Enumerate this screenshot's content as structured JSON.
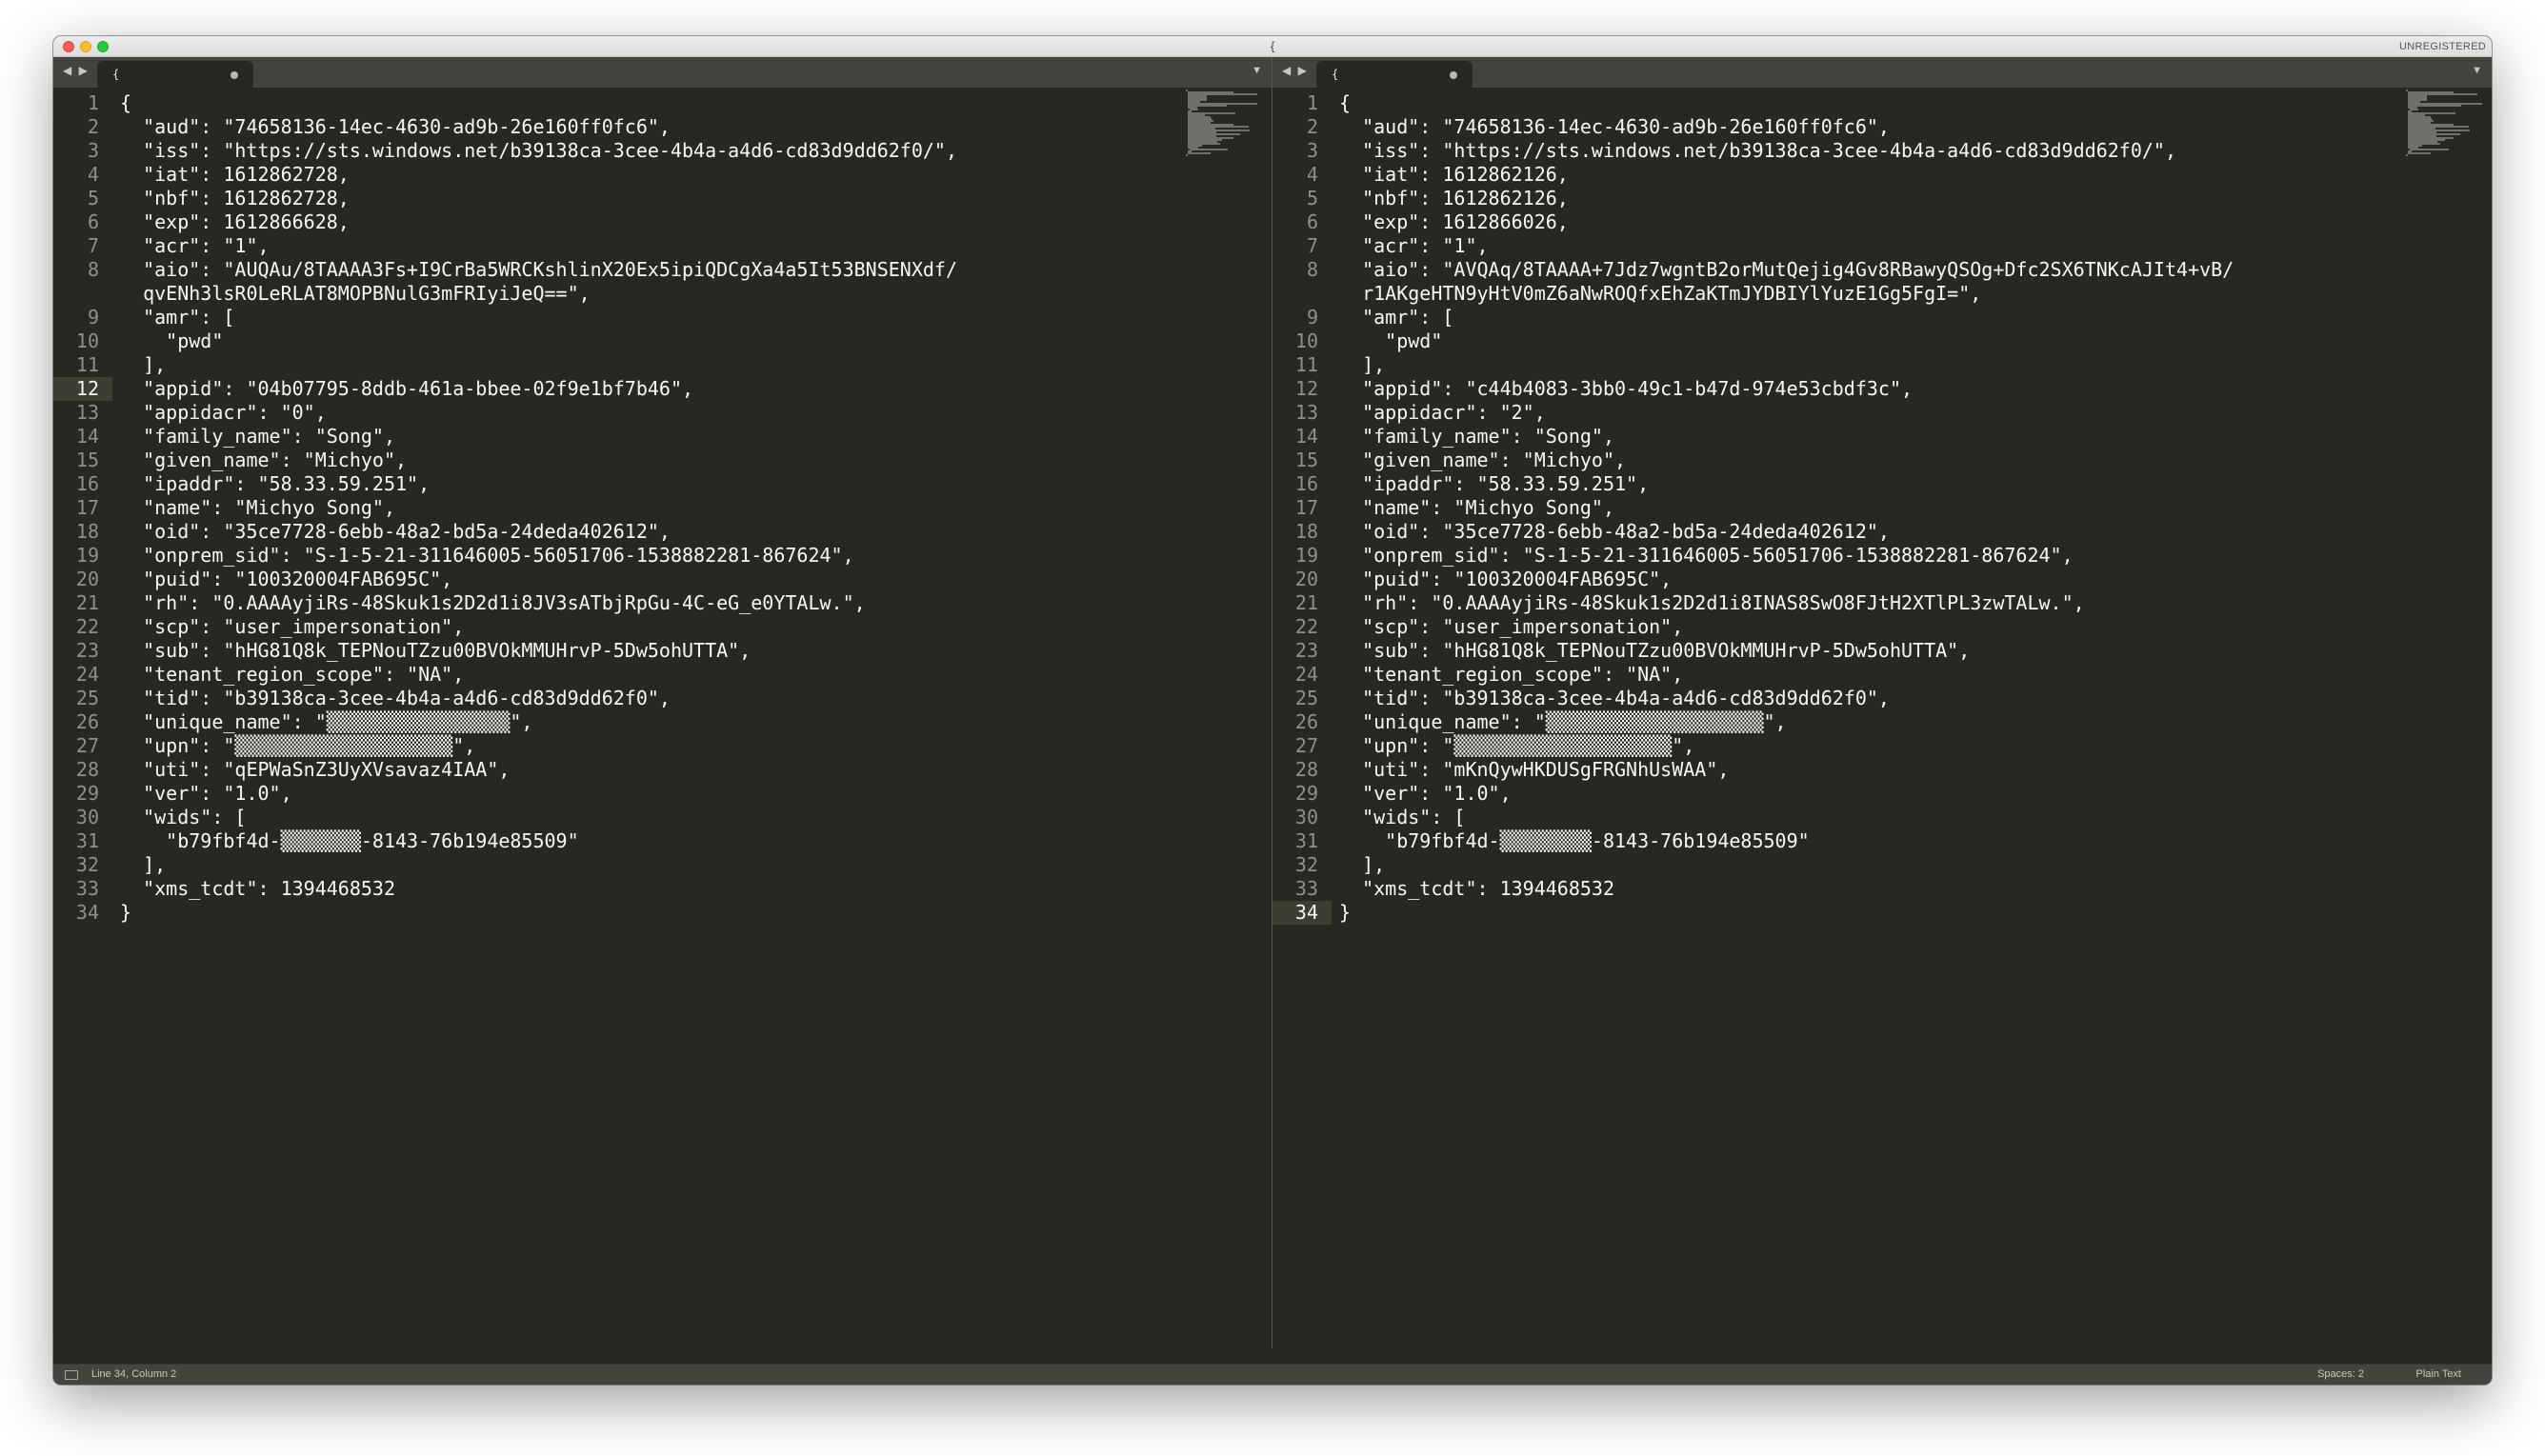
{
  "window": {
    "title": "{",
    "registration": "UNREGISTERED",
    "nav_arrows": "◀ ▶"
  },
  "status": {
    "position": "Line 34, Column 2",
    "spaces": "Spaces: 2",
    "syntax": "Plain Text"
  },
  "colors": {
    "editor_bg": "#272822",
    "text": "#f8f8f2",
    "line_numbers": "#8f908a",
    "chrome": "#43443d"
  },
  "panes": [
    {
      "tab_title": "{",
      "current_line": 12,
      "lines": [
        {
          "n": "1",
          "t": "{"
        },
        {
          "n": "2",
          "t": "  \"aud\": \"74658136-14ec-4630-ad9b-26e160ff0fc6\","
        },
        {
          "n": "3",
          "t": "  \"iss\": \"https://sts.windows.net/b39138ca-3cee-4b4a-a4d6-cd83d9dd62f0/\","
        },
        {
          "n": "4",
          "t": "  \"iat\": 1612862728,"
        },
        {
          "n": "5",
          "t": "  \"nbf\": 1612862728,"
        },
        {
          "n": "6",
          "t": "  \"exp\": 1612866628,"
        },
        {
          "n": "7",
          "t": "  \"acr\": \"1\","
        },
        {
          "n": "8",
          "t": "  \"aio\": \"AUQAu/8TAAAA3Fs+I9CrBa5WRCKshlinX20Ex5ipiQDCgXa4a5It53BNSENXdf/"
        },
        {
          "n": "",
          "t": "  qvENh3lsR0LeRLAT8MOPBNulG3mFRIyiJeQ==\","
        },
        {
          "n": "9",
          "t": "  \"amr\": ["
        },
        {
          "n": "10",
          "t": "    \"pwd\""
        },
        {
          "n": "11",
          "t": "  ],"
        },
        {
          "n": "12",
          "t": "  \"appid\": \"04b07795-8ddb-461a-bbee-02f9e1bf7b46\","
        },
        {
          "n": "13",
          "t": "  \"appidacr\": \"0\","
        },
        {
          "n": "14",
          "t": "  \"family_name\": \"Song\","
        },
        {
          "n": "15",
          "t": "  \"given_name\": \"Michyo\","
        },
        {
          "n": "16",
          "t": "  \"ipaddr\": \"58.33.59.251\","
        },
        {
          "n": "17",
          "t": "  \"name\": \"Michyo Song\","
        },
        {
          "n": "18",
          "t": "  \"oid\": \"35ce7728-6ebb-48a2-bd5a-24deda402612\","
        },
        {
          "n": "19",
          "t": "  \"onprem_sid\": \"S-1-5-21-311646005-56051706-1538882281-867624\","
        },
        {
          "n": "20",
          "t": "  \"puid\": \"100320004FAB695C\","
        },
        {
          "n": "21",
          "t": "  \"rh\": \"0.AAAAyjiRs-48Skuk1s2D2d1i8JV3sATbjRpGu-4C-eG_e0YTALw.\","
        },
        {
          "n": "22",
          "t": "  \"scp\": \"user_impersonation\","
        },
        {
          "n": "23",
          "t": "  \"sub\": \"hHG81Q8k_TEPNouTZzu00BVOkMMUHrvP-5Dw5ohUTTA\","
        },
        {
          "n": "24",
          "t": "  \"tenant_region_scope\": \"NA\","
        },
        {
          "n": "25",
          "t": "  \"tid\": \"b39138ca-3cee-4b4a-a4d6-cd83d9dd62f0\","
        },
        {
          "n": "26",
          "t": "  \"unique_name\": \"▒▒▒▒▒▒▒▒▒▒▒▒▒▒▒▒\","
        },
        {
          "n": "27",
          "t": "  \"upn\": \"▒▒▒▒▒▒▒▒▒▒▒▒▒▒▒▒▒▒▒\","
        },
        {
          "n": "28",
          "t": "  \"uti\": \"qEPWaSnZ3UyXVsavaz4IAA\","
        },
        {
          "n": "29",
          "t": "  \"ver\": \"1.0\","
        },
        {
          "n": "30",
          "t": "  \"wids\": ["
        },
        {
          "n": "31",
          "t": "    \"b79fbf4d-▒▒▒▒▒▒▒-8143-76b194e85509\""
        },
        {
          "n": "32",
          "t": "  ],"
        },
        {
          "n": "33",
          "t": "  \"xms_tcdt\": 1394468532"
        },
        {
          "n": "34",
          "t": "}"
        }
      ]
    },
    {
      "tab_title": "{",
      "current_line": 34,
      "lines": [
        {
          "n": "1",
          "t": "{"
        },
        {
          "n": "2",
          "t": "  \"aud\": \"74658136-14ec-4630-ad9b-26e160ff0fc6\","
        },
        {
          "n": "3",
          "t": "  \"iss\": \"https://sts.windows.net/b39138ca-3cee-4b4a-a4d6-cd83d9dd62f0/\","
        },
        {
          "n": "4",
          "t": "  \"iat\": 1612862126,"
        },
        {
          "n": "5",
          "t": "  \"nbf\": 1612862126,"
        },
        {
          "n": "6",
          "t": "  \"exp\": 1612866026,"
        },
        {
          "n": "7",
          "t": "  \"acr\": \"1\","
        },
        {
          "n": "8",
          "t": "  \"aio\": \"AVQAq/8TAAAA+7Jdz7wgntB2orMutQejig4Gv8RBawyQSOg+Dfc2SX6TNKcAJIt4+vB/"
        },
        {
          "n": "",
          "t": "  r1AKgeHTN9yHtV0mZ6aNwROQfxEhZaKTmJYDBIYlYuzE1Gg5FgI=\","
        },
        {
          "n": "9",
          "t": "  \"amr\": ["
        },
        {
          "n": "10",
          "t": "    \"pwd\""
        },
        {
          "n": "11",
          "t": "  ],"
        },
        {
          "n": "12",
          "t": "  \"appid\": \"c44b4083-3bb0-49c1-b47d-974e53cbdf3c\","
        },
        {
          "n": "13",
          "t": "  \"appidacr\": \"2\","
        },
        {
          "n": "14",
          "t": "  \"family_name\": \"Song\","
        },
        {
          "n": "15",
          "t": "  \"given_name\": \"Michyo\","
        },
        {
          "n": "16",
          "t": "  \"ipaddr\": \"58.33.59.251\","
        },
        {
          "n": "17",
          "t": "  \"name\": \"Michyo Song\","
        },
        {
          "n": "18",
          "t": "  \"oid\": \"35ce7728-6ebb-48a2-bd5a-24deda402612\","
        },
        {
          "n": "19",
          "t": "  \"onprem_sid\": \"S-1-5-21-311646005-56051706-1538882281-867624\","
        },
        {
          "n": "20",
          "t": "  \"puid\": \"100320004FAB695C\","
        },
        {
          "n": "21",
          "t": "  \"rh\": \"0.AAAAyjiRs-48Skuk1s2D2d1i8INAS8SwO8FJtH2XTlPL3zwTALw.\","
        },
        {
          "n": "22",
          "t": "  \"scp\": \"user_impersonation\","
        },
        {
          "n": "23",
          "t": "  \"sub\": \"hHG81Q8k_TEPNouTZzu00BVOkMMUHrvP-5Dw5ohUTTA\","
        },
        {
          "n": "24",
          "t": "  \"tenant_region_scope\": \"NA\","
        },
        {
          "n": "25",
          "t": "  \"tid\": \"b39138ca-3cee-4b4a-a4d6-cd83d9dd62f0\","
        },
        {
          "n": "26",
          "t": "  \"unique_name\": \"▒▒▒▒▒▒▒▒▒▒▒▒▒▒▒▒▒▒▒\","
        },
        {
          "n": "27",
          "t": "  \"upn\": \"▒▒▒▒▒▒▒▒▒▒▒▒▒▒▒▒▒▒▒\","
        },
        {
          "n": "28",
          "t": "  \"uti\": \"mKnQywHKDUSgFRGNhUsWAA\","
        },
        {
          "n": "29",
          "t": "  \"ver\": \"1.0\","
        },
        {
          "n": "30",
          "t": "  \"wids\": ["
        },
        {
          "n": "31",
          "t": "    \"b79fbf4d-▒▒▒▒▒▒▒▒-8143-76b194e85509\""
        },
        {
          "n": "32",
          "t": "  ],"
        },
        {
          "n": "33",
          "t": "  \"xms_tcdt\": 1394468532"
        },
        {
          "n": "34",
          "t": "}"
        }
      ]
    }
  ]
}
